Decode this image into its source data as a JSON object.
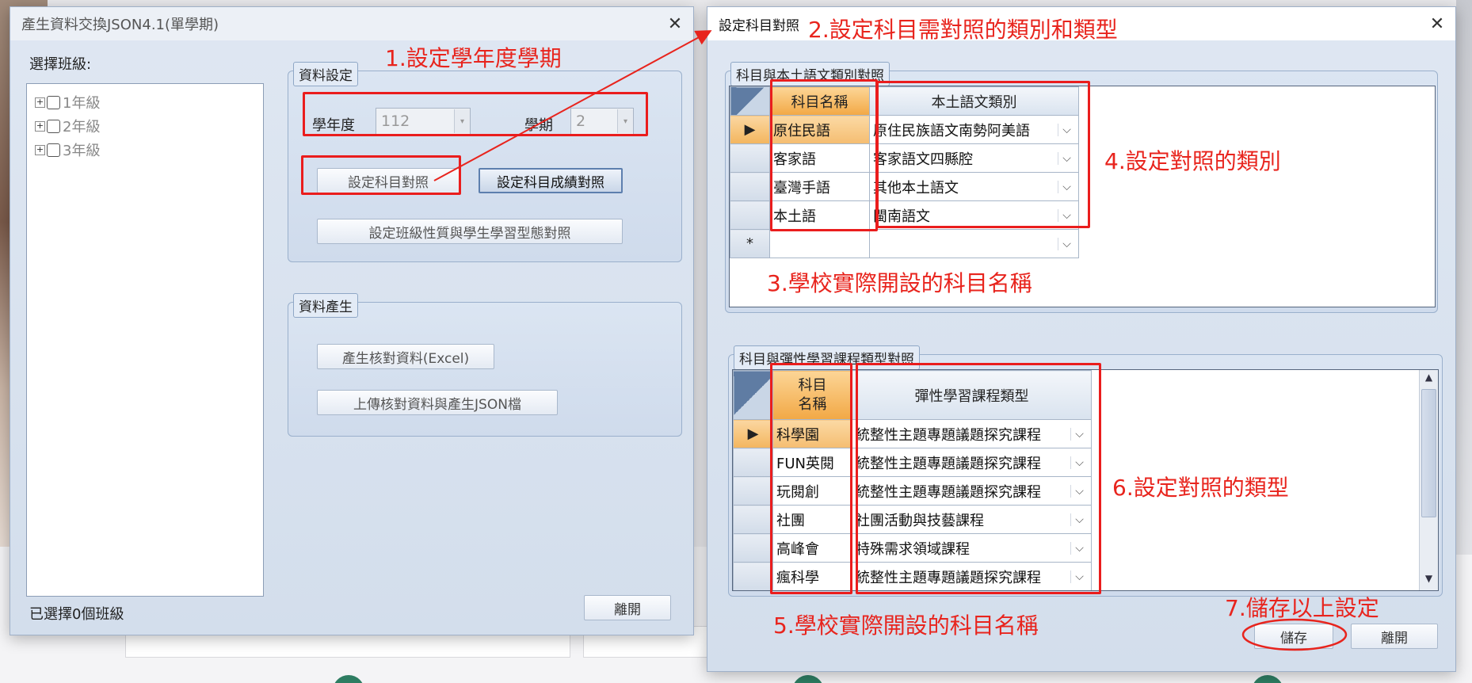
{
  "left_window": {
    "title": "產生資料交換JSON4.1(單學期)",
    "select_class_label": "選擇班級:",
    "tree": [
      {
        "label": "1年級"
      },
      {
        "label": "2年級"
      },
      {
        "label": "3年級"
      }
    ],
    "status_text": "已選擇0個班級",
    "leave_button": "離開",
    "data_settings": {
      "group_title": "資料設定",
      "year_label": "學年度",
      "year_value": "112",
      "semester_label": "學期",
      "semester_value": "2",
      "subject_map_button": "設定科目對照",
      "score_map_button": "設定科目成績對照",
      "class_type_button": "設定班級性質與學生學習型態對照"
    },
    "data_generate": {
      "group_title": "資料產生",
      "excel_button": "產生核對資料(Excel)",
      "upload_button": "上傳核對資料與產生JSON檔"
    }
  },
  "right_window": {
    "title": "設定科目對照",
    "group1": {
      "title": "科目與本土語文類別對照",
      "headers": [
        "科目名稱",
        "本土語文類別"
      ],
      "rows": [
        {
          "subject": "原住民語",
          "category": "原住民族語文南勢阿美語"
        },
        {
          "subject": "客家語",
          "category": "客家語文四縣腔"
        },
        {
          "subject": "臺灣手語",
          "category": "其他本土語文"
        },
        {
          "subject": "本土語",
          "category": "閩南語文"
        }
      ],
      "new_row_marker": "*"
    },
    "group2": {
      "title": "科目與彈性學習課程類型對照",
      "headers": [
        "科目\n名稱",
        "彈性學習課程類型"
      ],
      "rows": [
        {
          "subject": "科學園",
          "type": "統整性主題專題議題探究課程"
        },
        {
          "subject": "FUN英閱",
          "type": "統整性主題專題議題探究課程"
        },
        {
          "subject": "玩閱創",
          "type": "統整性主題專題議題探究課程"
        },
        {
          "subject": "社團",
          "type": "社團活動與技藝課程"
        },
        {
          "subject": "高峰會",
          "type": "特殊需求領域課程"
        },
        {
          "subject": "瘋科學",
          "type": "統整性主題專題議題探究課程"
        }
      ]
    },
    "save_button": "儲存",
    "leave_button": "離開"
  },
  "annotations": {
    "a1": "1.設定學年度學期",
    "a2": "2.設定科目需對照的類別和類型",
    "a3": "3.學校實際開設的科目名稱",
    "a4": "4.設定對照的類別",
    "a5": "5.學校實際開設的科目名稱",
    "a6": "6.設定對照的類型",
    "a7": "7.儲存以上設定"
  },
  "colors": {
    "annotation": "#e8241d",
    "highlight_row": "#f5bd71"
  }
}
